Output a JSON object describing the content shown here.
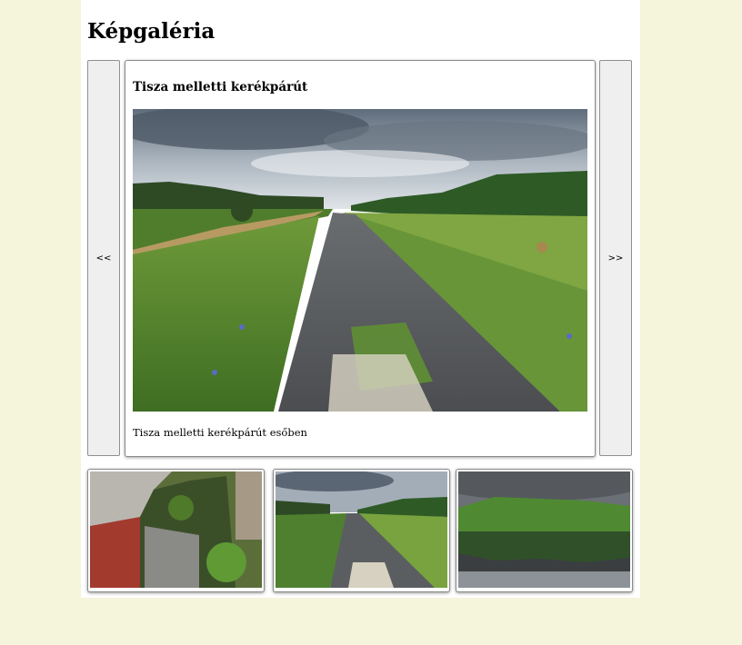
{
  "page": {
    "title": "Képgaléria"
  },
  "nav": {
    "prev_label": "<<",
    "next_label": ">>"
  },
  "featured": {
    "title": "Tisza melletti kerékpárút",
    "caption": "Tisza melletti kerékpárút esőben",
    "image_icon": "bike-path-photo"
  },
  "thumbnails": [
    {
      "image_icon": "ruined-wall-photo"
    },
    {
      "image_icon": "bike-path-photo"
    },
    {
      "image_icon": "river-reflection-photo"
    }
  ],
  "colors": {
    "page_bg": "#f5f5dc",
    "content_bg": "#ffffff",
    "button_bg": "#efefef",
    "border": "#8a8a8a"
  }
}
